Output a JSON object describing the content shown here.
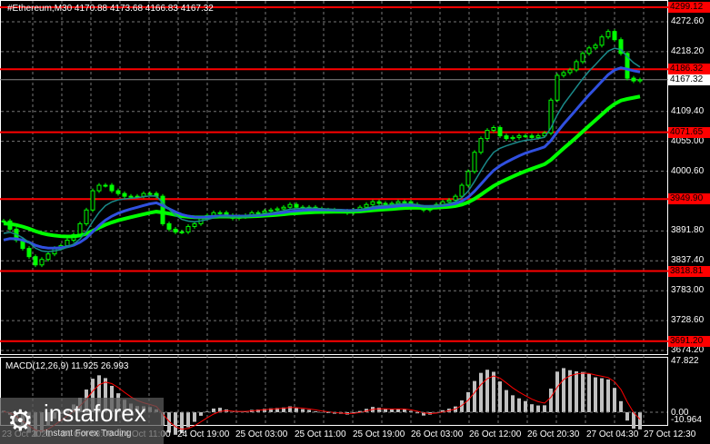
{
  "header": {
    "title": "#Ethereum,M30  4170.88 4173.68 4166.83 4167.32"
  },
  "yaxis": [
    "4272.60",
    "4218.20",
    "4109.40",
    "4055.00",
    "4000.60",
    "3891.80",
    "3837.40",
    "3783.00",
    "3728.60",
    "3674.20"
  ],
  "yvals": [
    4272.6,
    4218.2,
    4109.4,
    4055.0,
    4000.6,
    3891.8,
    3837.4,
    3783.0,
    3728.6,
    3674.2
  ],
  "levels": [
    {
      "label": "4299.12",
      "value": 4299.12
    },
    {
      "label": "4186.32",
      "value": 4186.32
    },
    {
      "label": "4071.65",
      "value": 4071.65
    },
    {
      "label": "3949.90",
      "value": 3949.9
    },
    {
      "label": "3818.81",
      "value": 3818.81
    },
    {
      "label": "3691.20",
      "value": 3691.2
    }
  ],
  "current": {
    "label": "4167.32",
    "value": 4167.32
  },
  "macd": {
    "label": "MACD(12,26,9) 11.925 26.993",
    "max_label": "47.822",
    "zero_label": "0.00",
    "min_label": "-10.964"
  },
  "xaxis": [
    "23 Oct 2021",
    "24 Oct 03:00",
    "24 Oct 11:00",
    "24 Oct 19:00",
    "25 Oct 03:00",
    "25 Oct 11:00",
    "25 Oct 19:00",
    "26 Oct 03:00",
    "26 Oct 12:00",
    "26 Oct 20:30",
    "27 Oct 04:30",
    "27 Oct 12:30"
  ],
  "logo": {
    "name": "instaforex",
    "tagline": "Instant Forex Trading"
  },
  "colors": {
    "level": "#ff0000",
    "up": "#00ff00",
    "ma_fast": "#1a8a8a",
    "ma_mid": "#3050e0",
    "ma_slow": "#00ff00",
    "hist": "#c0c0c0",
    "signal": "#ff0000"
  },
  "closes": [
    3910,
    3895,
    3875,
    3860,
    3845,
    3830,
    3840,
    3850,
    3860,
    3865,
    3875,
    3885,
    3905,
    3930,
    3965,
    3975,
    3975,
    3965,
    3960,
    3955,
    3955,
    3955,
    3960,
    3960,
    3955,
    3905,
    3895,
    3890,
    3890,
    3900,
    3905,
    3915,
    3920,
    3925,
    3925,
    3920,
    3915,
    3918,
    3920,
    3925,
    3925,
    3928,
    3930,
    3932,
    3935,
    3940,
    3935,
    3935,
    3935,
    3932,
    3930,
    3930,
    3928,
    3928,
    3925,
    3930,
    3935,
    3940,
    3945,
    3942,
    3940,
    3942,
    3945,
    3945,
    3940,
    3935,
    3930,
    3935,
    3940,
    3945,
    3948,
    3955,
    3975,
    4000,
    4035,
    4060,
    4075,
    4080,
    4065,
    4060,
    4062,
    4065,
    4065,
    4062,
    4065,
    4070,
    4130,
    4175,
    4180,
    4185,
    4200,
    4215,
    4225,
    4230,
    4245,
    4255,
    4240,
    4215,
    4170,
    4165,
    4167
  ]
}
